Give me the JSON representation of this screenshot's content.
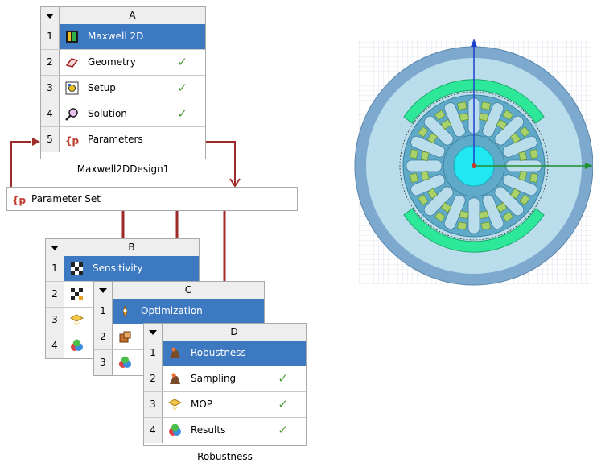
{
  "system_a": {
    "column": "A",
    "caption": "Maxwell2DDesign1",
    "rows": [
      {
        "num": "1",
        "label": "Maxwell 2D",
        "icon": "maxwell-2d-icon"
      },
      {
        "num": "2",
        "label": "Geometry",
        "icon": "geometry-icon",
        "check": "✓"
      },
      {
        "num": "3",
        "label": "Setup",
        "icon": "setup-icon",
        "check": "✓"
      },
      {
        "num": "4",
        "label": "Solution",
        "icon": "solution-icon",
        "check": "✓"
      },
      {
        "num": "5",
        "label": "Parameters",
        "icon": "parameters-icon"
      }
    ]
  },
  "parameter_set": {
    "label": "Parameter Set",
    "icon": "parameter-set-icon"
  },
  "system_b": {
    "column": "B",
    "rows": [
      {
        "num": "1",
        "label": "Sensitivity",
        "icon": "sensitivity-icon"
      },
      {
        "num": "2",
        "icon": "sampling-icon"
      },
      {
        "num": "3",
        "icon": "mop-icon"
      },
      {
        "num": "4",
        "icon": "results-icon"
      }
    ]
  },
  "system_c": {
    "column": "C",
    "rows": [
      {
        "num": "1",
        "label": "Optimization",
        "icon": "optimization-icon"
      },
      {
        "num": "2",
        "icon": "optimizer-icon"
      },
      {
        "num": "3",
        "icon": "results-icon"
      }
    ]
  },
  "system_d": {
    "column": "D",
    "caption": "Robustness",
    "rows": [
      {
        "num": "1",
        "label": "Robustness",
        "icon": "robustness-icon"
      },
      {
        "num": "2",
        "label": "Sampling",
        "icon": "sampling-icon",
        "check": "✓"
      },
      {
        "num": "3",
        "label": "MOP",
        "icon": "mop-icon",
        "check": "✓"
      },
      {
        "num": "4",
        "label": "Results",
        "icon": "results-icon",
        "check": "✓"
      }
    ]
  },
  "colors": {
    "selected_row": "#3d79c0",
    "link": "#9e2a2a",
    "check": "#4e9a3a",
    "stator": "#7ea9cf",
    "rotor": "#5fa9c9",
    "magnet": "#2ee89a",
    "shaft": "#22e6f2"
  }
}
